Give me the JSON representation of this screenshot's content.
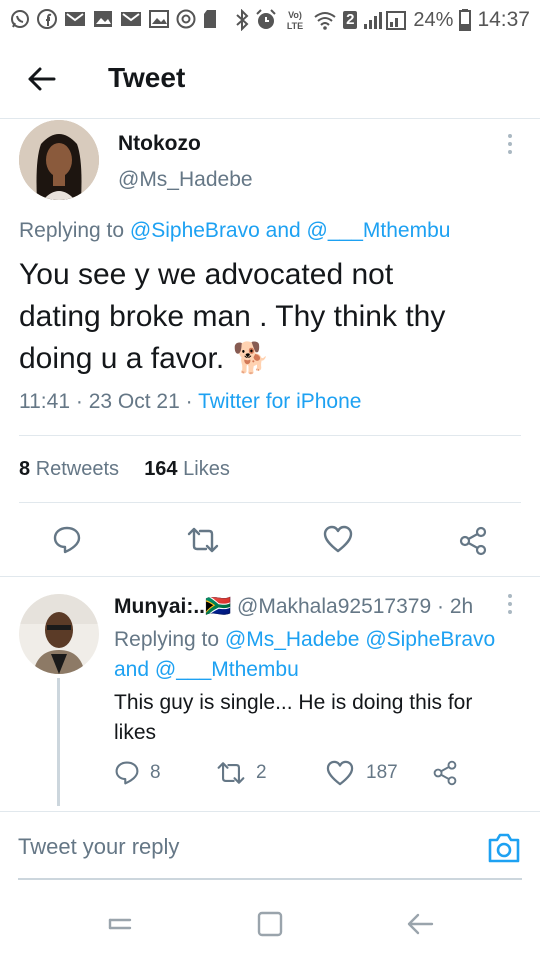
{
  "status_bar": {
    "battery_percent": "24%",
    "time": "14:37",
    "sim_badge": "2",
    "left_icons": [
      "whatsapp-icon",
      "facebook-icon",
      "gmail-icon",
      "gallery-icon",
      "gmail-icon",
      "gallery-icon",
      "chrome-icon",
      "sd-card-icon"
    ],
    "right_icons": [
      "bluetooth-icon",
      "alarm-icon",
      "volte-icon",
      "wifi-icon",
      "signal-icon",
      "battery-icon"
    ]
  },
  "header": {
    "title": "Tweet"
  },
  "main_tweet": {
    "author_name": "Ntokozo",
    "author_handle": "@Ms_Hadebe",
    "replying_prefix": "Replying to",
    "replying_user1": "@SipheBravo",
    "replying_and": "and",
    "replying_user2": "@___Mthembu",
    "text_line1": "You see y we advocated not",
    "text_line2": "dating broke man . Thy think thy",
    "text_line3": "doing u a favor.",
    "emoji": "🐕",
    "time": "11:41",
    "sep1": "·",
    "date": "23 Oct 21",
    "sep2": "·",
    "source": "Twitter for iPhone",
    "retweets_count": "8",
    "retweets_label": "Retweets",
    "likes_count": "164",
    "likes_label": "Likes"
  },
  "reply": {
    "author_name": "Munyai:..",
    "flag": "🇿🇦",
    "author_handle": "@Makhala92517379",
    "age": "· 2h",
    "replying_prefix": "Replying to",
    "replying_user1": "@Ms_Hadebe",
    "replying_user2": "@SipheBravo",
    "replying_and": "and",
    "replying_user3": "@___Mthembu",
    "text_line1": "This guy is single... He is doing this for",
    "text_line2": "likes",
    "reply_count": "8",
    "retweet_count": "2",
    "like_count": "187"
  },
  "compose": {
    "placeholder": "Tweet your reply"
  },
  "colors": {
    "accent": "#1da1f2",
    "text": "#14171a",
    "secondary": "#657786",
    "divider": "#e1e8ed"
  }
}
